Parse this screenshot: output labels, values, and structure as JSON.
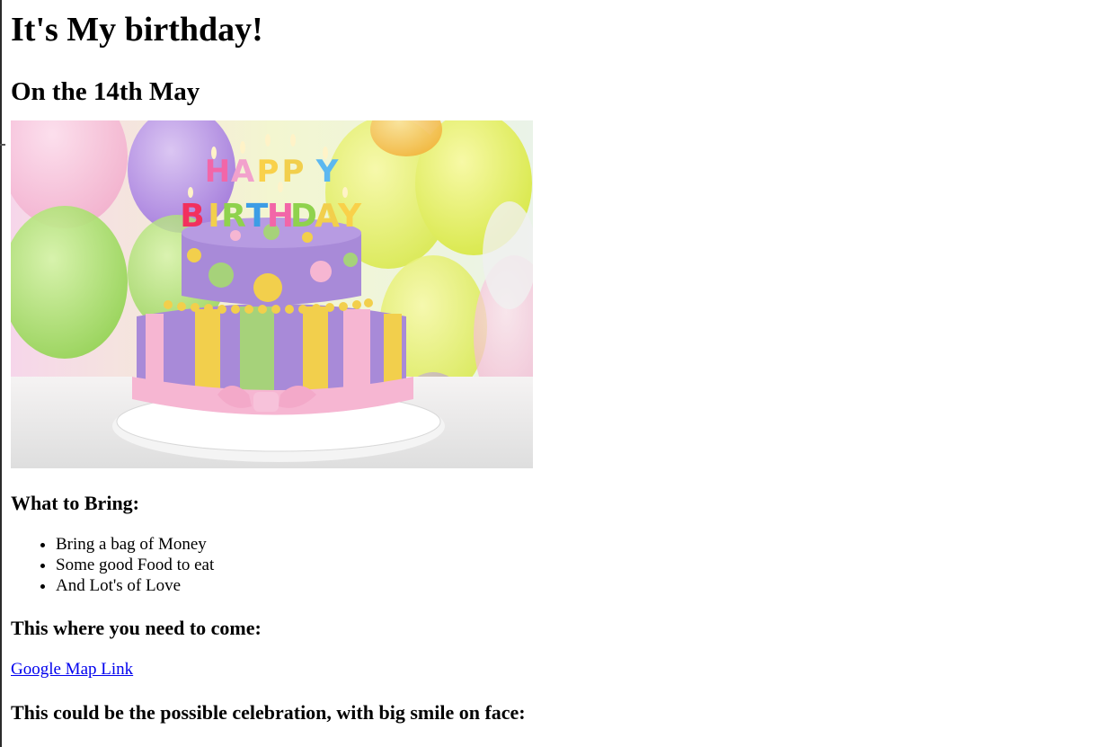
{
  "page": {
    "title": "It's My birthday!",
    "subtitle": "On the 14th May"
  },
  "hero_image": {
    "candle_letters_line1": "HAPPY",
    "candle_letters_line2": "BIRTHDAY",
    "colors": {
      "background_balloon_yellow": "#e9f06a",
      "background_balloon_purple": "#b48ce6",
      "background_balloon_green": "#a8e86a",
      "cake_purple": "#a88ad8",
      "stripe_pink": "#f6b6d2",
      "stripe_yellow": "#f2cf4c",
      "stripe_green": "#a6d27a",
      "plate_white": "#f4f4f4"
    }
  },
  "bring": {
    "heading": "What to Bring:",
    "items": [
      "Bring a bag of Money",
      "Some good Food to eat",
      "And Lot's of Love"
    ]
  },
  "location": {
    "heading": "This where you need to come:",
    "link_label": "Google Map Link",
    "link_color": "#0000ee"
  },
  "celebration": {
    "heading": "This could be the possible celebration, with big smile on face:"
  }
}
